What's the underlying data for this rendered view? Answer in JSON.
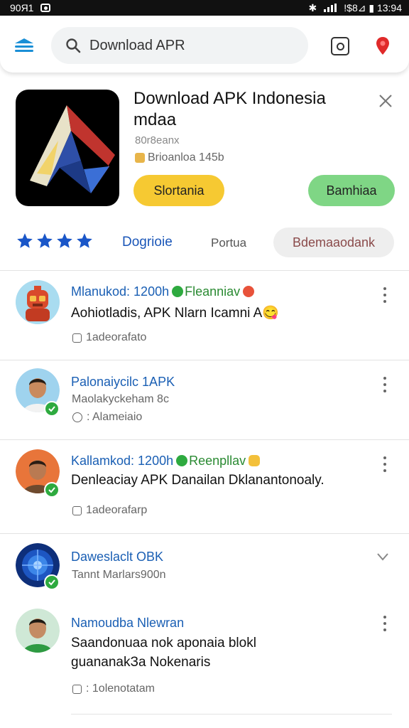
{
  "status_bar": {
    "left_text": "90Я1",
    "right_text": "!$8⊿ ▮ 13:94"
  },
  "search": {
    "query": "Download APR"
  },
  "app": {
    "title": "Download APK Indonesia mdaa",
    "subtitle": "80r8eanx",
    "size": "Brioanloa 145b",
    "primary_button": "Slortania",
    "secondary_button": "Bamhiaa"
  },
  "rating": {
    "stars": 4
  },
  "tabs": [
    {
      "label": "Dogrioie"
    },
    {
      "label": "Portua"
    },
    {
      "label": "Bdemaaodank"
    }
  ],
  "reviews": [
    {
      "title": "Mlanukod: 1200h",
      "tag": "Fleanniav",
      "text": "Aohiotladis, APK Nlarn Icamni A😋",
      "meta": "1adeorafato"
    },
    {
      "title": "Palonaiycilc 1APK",
      "subtitle": "Maolakyckeham 8c",
      "meta": ": Alameiaio"
    },
    {
      "title": "Kallamkod: 1200h",
      "tag": "Reenpllav",
      "text": "Denleaciay APK Danailan Dklanantonoaly.",
      "meta": "1adeorafarp"
    },
    {
      "title": "Daweslaclt OBK",
      "subtitle": "Tannt Marlars900n"
    },
    {
      "title": "Namoudba Nlewran",
      "text": "Saandonuaa nok aponaia blokl",
      "text2": "guananakЗa Nokenaris",
      "meta": ": 1olenotatam"
    }
  ],
  "colors": {
    "accent_blue": "#1a5fb4",
    "yellow_button": "#f6c932",
    "green_button": "#7fd685",
    "verified_green": "#2eaa3f",
    "star_blue": "#1a56c8"
  }
}
